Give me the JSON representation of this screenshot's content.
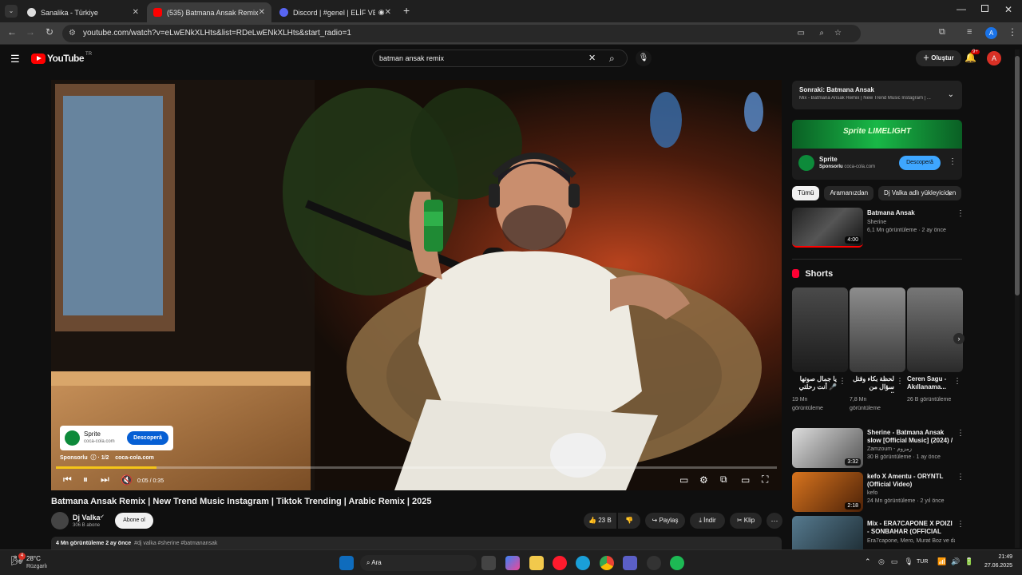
{
  "browser": {
    "tabs": [
      {
        "label": "Sanalika - Türkiye"
      },
      {
        "label": "(535) Batmana Ansak Remix | N"
      },
      {
        "label": "Discord | #genel | ELİF VE B"
      }
    ],
    "url": "youtube.com/watch?v=eLwENkXLHts&list=RDeLwENkXLHts&start_radio=1"
  },
  "yt": {
    "logo": "YouTube",
    "region": "TR",
    "search_value": "batman ansak remix",
    "create_label": "Oluştur",
    "notif_count": "9+",
    "avatar_letter": "A"
  },
  "player": {
    "ad_brand": "Sprite",
    "ad_domain": "coca-cola.com",
    "ad_cta": "Descoperă",
    "sponsored_line": "Sponsorlu  ⓘ · 1/2    coca-cola.com",
    "time": "0:05 / 0:35"
  },
  "video": {
    "title": "Batmana Ansak Remix | New Trend Music Instagram | Tiktok Trending | Arabic Remix | 2025",
    "channel": "Dj Valka",
    "subs": "306 B abone",
    "subscribe": "Abone ol",
    "likes": "23 B",
    "share": "Paylaş",
    "download": "İndir",
    "clip": "Klip",
    "desc_views": "4 Mn görüntüleme  2 ay önce",
    "desc_tags": "#dj valka #sherine #batmanansak"
  },
  "sidebar": {
    "next_title": "Sonraki: Batmana Ansak",
    "next_sub": "Mix - Batmana Ansak Remix | New Trend Music Instagram | ...",
    "ad_banner": "Sprite LIMELIGHT",
    "ad_name": "Sprite",
    "ad_sponsored": "Sponsorlu",
    "ad_domain": "coca-cola.com",
    "ad_cta": "Descoperă",
    "chips": [
      "Tümü",
      "Aramanızdan",
      "Dj Valka adlı yükleyiciden"
    ],
    "first_video": {
      "title": "Batmana Ansak",
      "channel": "Sherine",
      "meta": "6,1 Mn görüntüleme · 2 ay önce",
      "duration": "4:00"
    },
    "shorts_label": "Shorts",
    "shorts": [
      {
        "title": "يا جمال صوتها 🎤 أنت رحلتي متى",
        "views": "19 Mn görüntüleme"
      },
      {
        "title": "لحظة بكاء وقتل سؤال من الجمهور",
        "views": "7,8 Mn görüntüleme"
      },
      {
        "title": "Ceren Sagu - Akıllanama...",
        "views": "26 B görüntüleme"
      }
    ],
    "videos": [
      {
        "title": "Sherine - Batmana Ansak slow [Official Music] (2024) / - حيرين",
        "channel": "Zamzoum - زمزوم",
        "meta": "30 B görüntüleme · 1 ay önce",
        "duration": "3:32"
      },
      {
        "title": "kefo X Amentu - ORYNTL (Official Video)",
        "channel": "kefo",
        "meta": "24 Mn görüntüleme · 2 yıl önce",
        "duration": "2:18"
      },
      {
        "title": "Mix - ERA7CAPONE X POIZI - SONBAHAR (OFFICIAL MUSIC ...",
        "channel": "Era7capone, Mero, Murat Boz ve daha fa...",
        "meta": "",
        "duration": ""
      }
    ]
  },
  "taskbar": {
    "weather_temp": "28°C",
    "weather_desc": "Rüzgarlı",
    "weather_badge": "4",
    "search": "Ara",
    "lang": "TUR",
    "time": "21:49",
    "date": "27.06.2025"
  }
}
